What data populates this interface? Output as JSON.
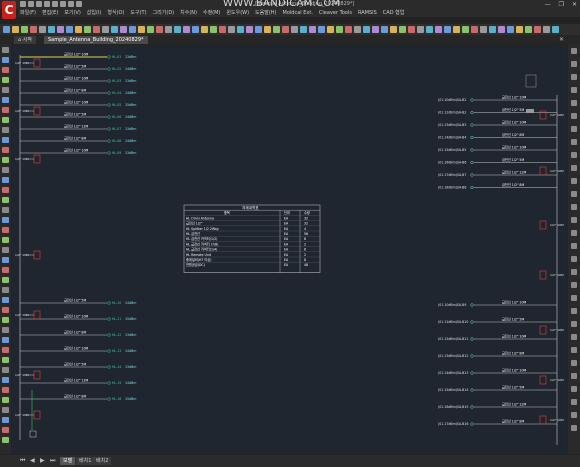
{
  "window": {
    "title": "[Sample_Antenna_Building_20240829*]",
    "watermark": "WWW.BANDICAM.COM",
    "controls": [
      "—",
      "❐",
      "✕"
    ]
  },
  "menu": [
    "파일(F)",
    "편집(E)",
    "보기(V)",
    "삽입(I)",
    "형식(O)",
    "도구(T)",
    "그리기(D)",
    "치수(N)",
    "수정(M)",
    "윈도우(W)",
    "도움말(H)",
    "Moldcal Ext.",
    "Cleaver Tools",
    "RAMSIS",
    "CAD 협업"
  ],
  "tabs": [
    {
      "label": "⌂ 시작"
    },
    {
      "label": "Sample_Antenna_Building_20240829*"
    }
  ],
  "legend": {
    "title": "자재내역표",
    "headers": [
      "품목",
      "단위",
      "수량"
    ],
    "rows": [
      [
        "HL Omni Antenna",
        "EA",
        "32"
      ],
      [
        "급전선 1/2\"",
        "EA",
        "32"
      ],
      [
        "HL Splitter 1/2 2Way",
        "EA",
        "4"
      ],
      [
        "HL 급전선",
        "EA",
        "56"
      ],
      [
        "HL 급전선 커넥터(1/2)",
        "EA",
        "8"
      ],
      [
        "HL 급전선 커넥터 (7/8)",
        "EA",
        "2"
      ],
      [
        "HL 급전선 커넥터(1/4)",
        "EA",
        "8"
      ],
      [
        "HL Remote Unit",
        "EA",
        "2"
      ],
      [
        "중계설비(HT 이상)",
        "EA",
        "8"
      ],
      [
        "전원공급(DC)",
        "EA",
        "48"
      ]
    ]
  },
  "left_column": {
    "labels": [
      "급전선 1/2\" 10M",
      "급전선 1/2\" 5M",
      "급전선 1/2\" 10M",
      "급전선 1/2\" 8M",
      "급전선 1/2\" 10M",
      "급전선 1/2\" 5M",
      "급전선 1/2\" 12M",
      "급전선 1/2\" 8M",
      "급전선 1/2\" 10M",
      "급전선 1/2\" 5M",
      "급전선 1/2\" 10M",
      "급전선 1/2\" 8M",
      "급전선 1/2\" 10M",
      "급전선 1/2\" 5M",
      "급전선 1/2\" 12M",
      "급전선 1/2\" 8M"
    ],
    "tags": [
      "HL-01",
      "HL-02",
      "HL-03",
      "HL-04",
      "HL-05",
      "HL-06",
      "HL-07",
      "HL-08",
      "HL-09",
      "HL-10",
      "HL-11",
      "HL-12",
      "HL-13",
      "HL-14",
      "HL-15",
      "HL-16"
    ],
    "values": [
      "13dBm",
      "14dBm",
      "13dBm",
      "14dBm",
      "15dBm",
      "14dBm",
      "13dBm",
      "14dBm",
      "13dBm",
      "14dBm",
      "15dBm",
      "13dBm",
      "14dBm",
      "13dBm",
      "14dBm",
      "15dBm"
    ]
  },
  "right_column": {
    "labels": [
      "급전선 1/2\" 10M",
      "급전선 1/2\" 5M",
      "급전선 1/2\" 10M",
      "급전선 1/2\" 8M",
      "급전선 1/2\" 10M",
      "급전선 1/2\" 5M",
      "급전선 1/2\" 12M",
      "급전선 1/2\" 8M",
      "급전선 1/2\" 10M",
      "급전선 1/2\" 5M",
      "급전선 1/2\" 10M",
      "급전선 1/2\" 8M",
      "급전선 1/2\" 10M",
      "급전선 1/2\" 5M",
      "급전선 1/2\" 12M",
      "급전선 1/2\" 8M"
    ],
    "tags": [
      "(01.10dBm)SA-B2",
      "(01.12dBm)SA-B2",
      "(01.13dBm)SA-B3",
      "(01.14dBm)SA-B4",
      "(01.15dBm)SA-B5",
      "(01.16dBm)SA-B6",
      "(01.17dBm)SA-B7",
      "(01.18dBm)SA-B8",
      "(01.10dBm)SA-B9",
      "(01.11dBm)SA-B10",
      "(01.12dBm)SA-B11",
      "(01.13dBm)SA-B12",
      "(01.14dBm)SA-B13",
      "(01.15dBm)SA-B14",
      "(01.16dBm)SA-B15",
      "(01.17dBm)SA-B16"
    ]
  },
  "splitter_label": "1/2\" 10M",
  "bottom_tabs": [
    "모델",
    "배치1",
    "배치2"
  ],
  "colors": {
    "canvas": "#1f2630",
    "line": "#c9c9c9",
    "tag_green": "#3fd28a",
    "tag_cyan": "#6fe3e3",
    "splitter_red": "#e04040",
    "yellow": "#e6d24a"
  }
}
